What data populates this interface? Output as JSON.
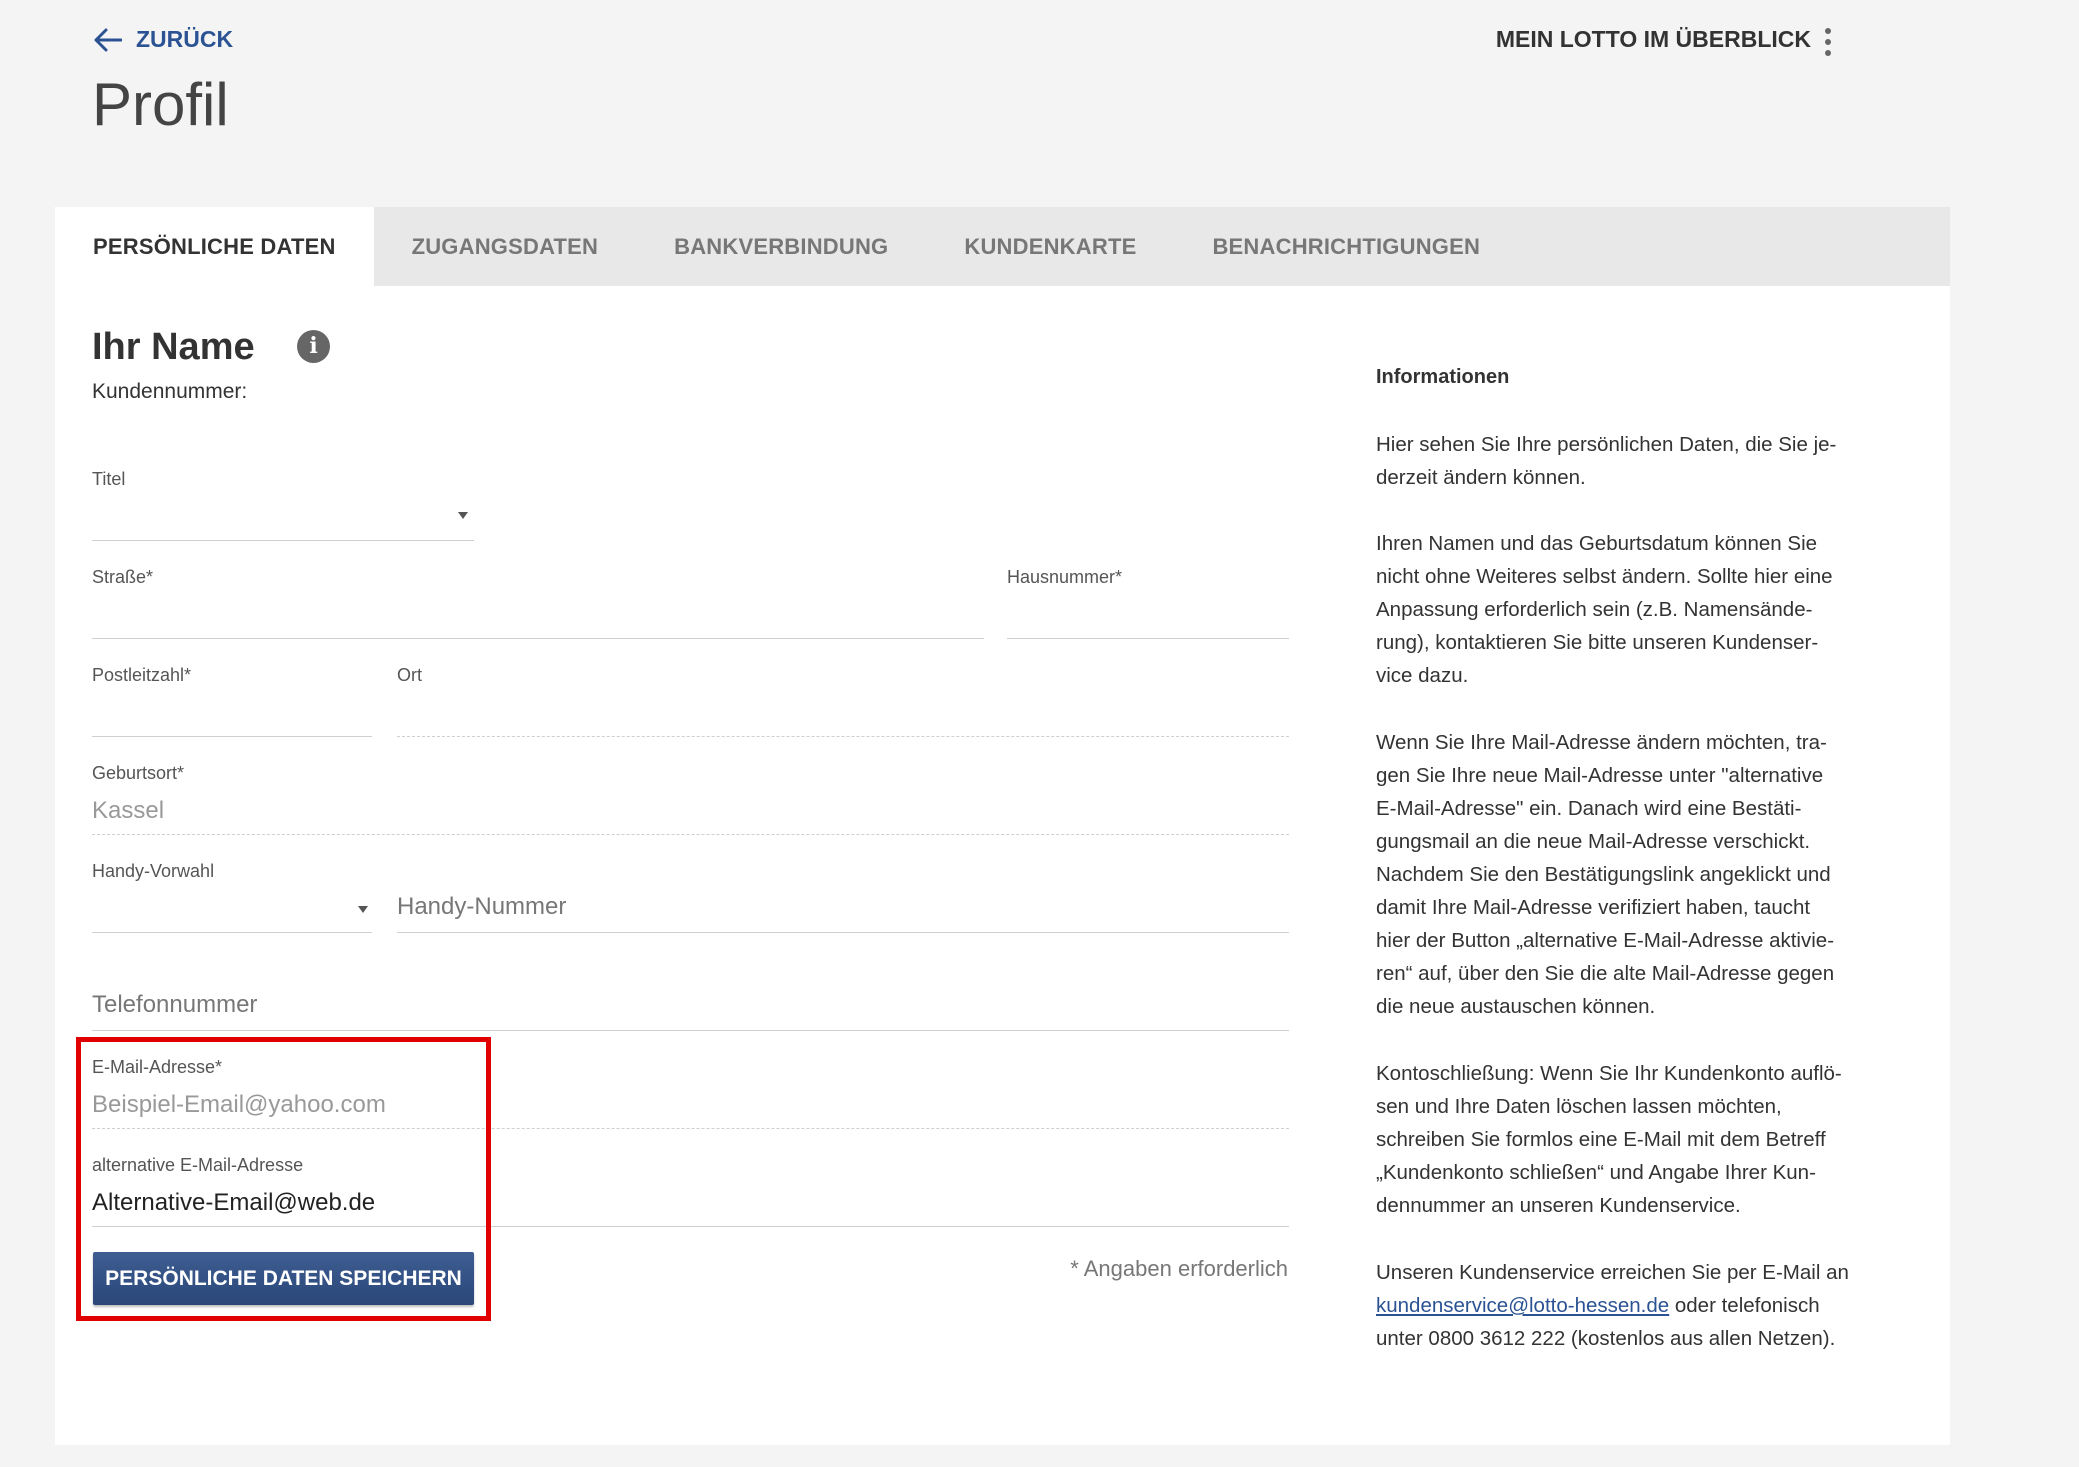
{
  "header": {
    "back_label": "ZURÜCK",
    "page_title": "Profil",
    "overview_label": "MEIN LOTTO IM ÜBERBLICK"
  },
  "tabs": [
    {
      "label": "PERSÖNLICHE DATEN",
      "active": true
    },
    {
      "label": "ZUGANGSDATEN",
      "active": false
    },
    {
      "label": "BANKVERBINDUNG",
      "active": false
    },
    {
      "label": "KUNDENKARTE",
      "active": false
    },
    {
      "label": "BENACHRICHTIGUNGEN",
      "active": false
    }
  ],
  "profile": {
    "name_heading": "Ihr Name",
    "customer_number_label": "Kundennummer:"
  },
  "form": {
    "titel": {
      "label": "Titel",
      "value": ""
    },
    "strasse": {
      "label": "Straße*",
      "value": ""
    },
    "hausnummer": {
      "label": "Hausnummer*",
      "value": ""
    },
    "plz": {
      "label": "Postleitzahl*",
      "value": ""
    },
    "ort": {
      "label": "Ort",
      "value": ""
    },
    "geburtsort": {
      "label": "Geburtsort*",
      "value": "Kassel"
    },
    "handy_vorwahl": {
      "label": "Handy-Vorwahl",
      "value": ""
    },
    "handy_nummer": {
      "placeholder": "Handy-Nummer"
    },
    "telefon": {
      "placeholder": "Telefonnummer"
    },
    "email": {
      "label": "E-Mail-Adresse*",
      "value": "Beispiel-Email@yahoo.com"
    },
    "alt_email": {
      "label": "alternative E-Mail-Adresse",
      "value": "Alternative-Email@web.de"
    },
    "save_label": "PERSÖNLICHE DATEN SPEICHERN",
    "required_note": "* Angaben erforderlich"
  },
  "info": {
    "title": "Informationen",
    "p1_l1": "Hier sehen Sie Ihre persönlichen Daten, die Sie je-",
    "p1_l2": "derzeit ändern können.",
    "p2_l1": "Ihren Namen und das Geburtsdatum können Sie",
    "p2_l2": "nicht ohne Weiteres selbst ändern. Sollte hier eine",
    "p2_l3": "Anpassung erforderlich sein (z.B. Namensände-",
    "p2_l4": "rung), kontaktieren Sie bitte unseren Kundenser-",
    "p2_l5": "vice dazu.",
    "p3_l1": "Wenn Sie Ihre Mail-Adresse ändern möchten, tra-",
    "p3_l2": "gen Sie Ihre neue Mail-Adresse unter \"alternative",
    "p3_l3": "E-Mail-Adresse\" ein. Danach wird eine Bestäti-",
    "p3_l4": "gungsmail an die neue Mail-Adresse verschickt.",
    "p3_l5": "Nachdem Sie den Bestätigungslink angeklickt und",
    "p3_l6": "damit Ihre Mail-Adresse verifiziert haben, taucht",
    "p3_l7": "hier der Button „alternative E-Mail-Adresse aktivie-",
    "p3_l8": "ren“ auf, über den Sie die alte Mail-Adresse gegen",
    "p3_l9": "die neue austauschen können.",
    "p4_l1": "Kontoschließung: Wenn Sie Ihr Kundenkonto auflö-",
    "p4_l2": "sen und Ihre Daten löschen lassen möchten,",
    "p4_l3": "schreiben Sie formlos eine E-Mail mit dem Betreff",
    "p4_l4": "„Kundenkonto schließen“ und Angabe Ihrer Kun-",
    "p4_l5": "dennummer an unseren Kundenservice.",
    "p5_l1": "Unseren Kundenservice erreichen Sie per E-Mail an",
    "p5_link": "kundenservice@lotto-hessen.de",
    "p5_after_link": " oder telefonisch",
    "p5_l3": "unter 0800 3612 222 (kostenlos aus allen Netzen)."
  },
  "colors": {
    "accent": "#2b5394",
    "button": "#34507f",
    "highlight": "#e00000"
  }
}
